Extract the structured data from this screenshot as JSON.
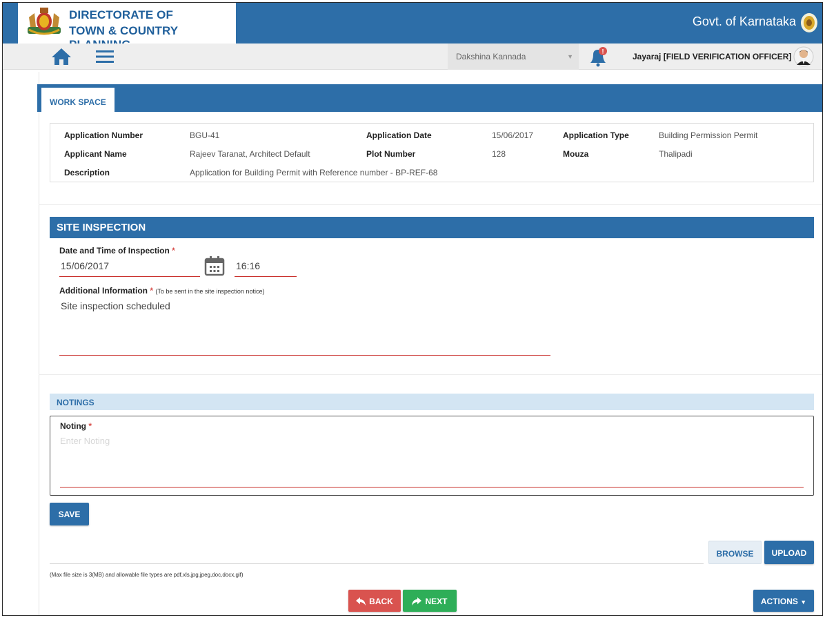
{
  "header": {
    "brand_line1": "DIRECTORATE OF",
    "brand_line2": "TOWN & COUNTRY PLANNING",
    "govt": "Govt. of Karnataka"
  },
  "navbar": {
    "district": "Dakshina Kannada",
    "notification_count": "!",
    "user": "Jayaraj [FIELD VERIFICATION OFFICER]"
  },
  "workspace": {
    "tab": "WORK SPACE",
    "application_number_label": "Application Number",
    "application_number": "BGU-41",
    "application_date_label": "Application Date",
    "application_date": "15/06/2017",
    "application_type_label": "Application Type",
    "application_type": "Building Permission Permit",
    "applicant_name_label": "Applicant Name",
    "applicant_name": "Rajeev Taranat, Architect Default",
    "plot_number_label": "Plot Number",
    "plot_number": "128",
    "mouza_label": "Mouza",
    "mouza": "Thalipadi",
    "description_label": "Description",
    "description": "Application for Building Permit with Reference number - BP-REF-68"
  },
  "site_inspection": {
    "title": "SITE INSPECTION",
    "datetime_label": "Date and Time of Inspection",
    "date": "15/06/2017",
    "time": "16:16",
    "additional_label": "Additional Information",
    "additional_note": "(To be sent in the site inspection notice)",
    "additional_value": "Site inspection scheduled"
  },
  "notings": {
    "title": "NOTINGS",
    "label": "Noting",
    "placeholder": "Enter Noting"
  },
  "actions": {
    "save": "SAVE",
    "browse": "BROWSE",
    "upload": "UPLOAD",
    "file_note": "(Max file size is 3(MB) and allowable file types are pdf,xls,jpg,jpeg,doc,docx,gif)",
    "back": "BACK",
    "next": "NEXT",
    "actions": "ACTIONS"
  },
  "colors": {
    "primary": "#2d6ea8",
    "danger": "#d9534f",
    "success": "#2eae58"
  }
}
